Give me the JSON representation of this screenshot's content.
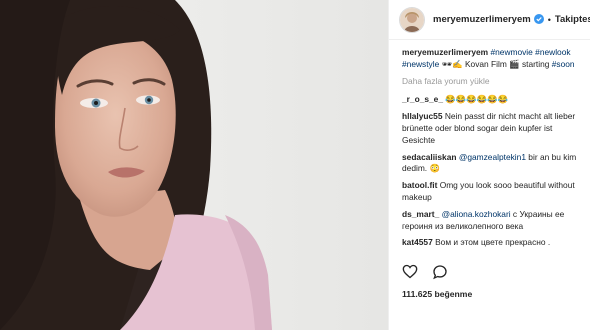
{
  "post": {
    "username": "meryemuzerlimeryem",
    "follow_label": "Takiptesin",
    "dot": "•",
    "caption_user": "meryemuzerlimeryem",
    "caption_tag1": "#newmovie",
    "caption_tag2": "#newlook",
    "caption_tag3": "#newstyle",
    "caption_middle": " 🕶✍ Kovan Film 🎬 ",
    "caption_end": "starting",
    "caption_tag4": "#soon",
    "load_more": "Daha fazla yorum yükle",
    "comments": [
      {
        "user": "_r_o_s_e_",
        "text": "😂😂😂😂😂😂"
      },
      {
        "user": "hllalyuc55",
        "text": "Nein passt dir nicht macht alt lieber brünette oder blond sogar dein kupfer ist Gesichte"
      },
      {
        "user": "sedacaliiskan",
        "mention": "@gamzealptekin1",
        "text": " bir an bu kim dedim. 😳"
      },
      {
        "user": "batool.fit",
        "text": "Omg you look sooo beautiful without makeup"
      },
      {
        "user": "ds_mart_",
        "mention": "@aliona.kozhokari",
        "text": " с Украины ее героиня из великолепного века"
      },
      {
        "user": "kat4557",
        "text": "Вом и этом цвете прекрасно ."
      }
    ],
    "likes": "111.625 beğenme"
  },
  "colors": {
    "verified": "#3897f0",
    "link": "#003569",
    "muted": "#999999"
  },
  "icons": [
    "heart-icon",
    "comment-icon"
  ]
}
